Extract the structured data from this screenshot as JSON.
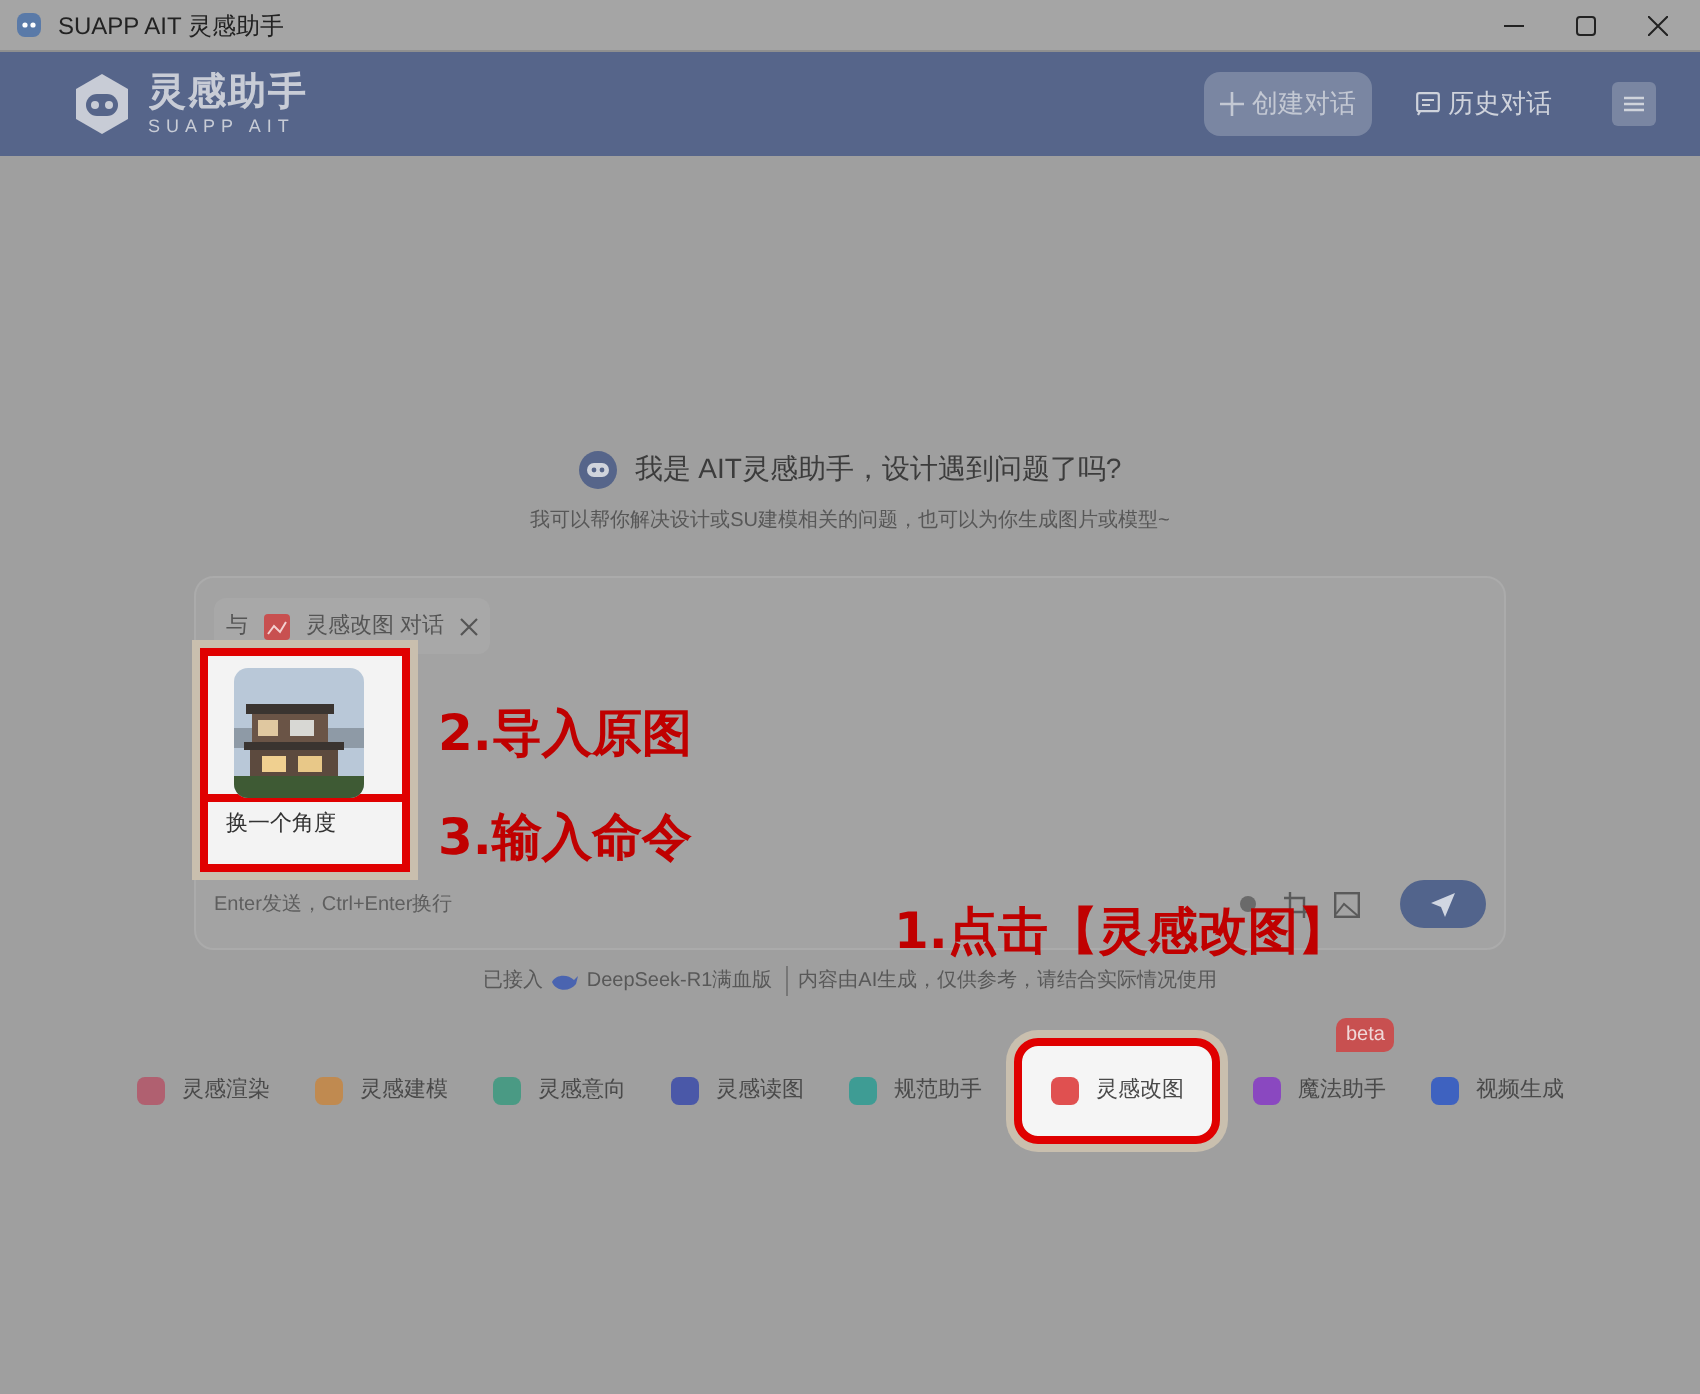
{
  "window": {
    "title": "SUAPP AIT 灵感助手"
  },
  "header": {
    "logo_title": "灵感助手",
    "logo_subtitle": "SUAPP AIT",
    "buttons": [
      {
        "label": "创建对话",
        "kind": "create"
      },
      {
        "label": "历史对话",
        "kind": "history"
      }
    ]
  },
  "welcome": {
    "title": "我是 AIT灵感助手，设计遇到问题了吗?",
    "subtitle": "我可以帮你解决设计或SU建模相关的问题，也可以为你生成图片或模型~"
  },
  "chat": {
    "chip": {
      "prefix": "与",
      "tool": "灵感改图",
      "suffix": "对话"
    },
    "image": {
      "kind": "picture",
      "highlighted": true
    },
    "input": {
      "value": "换一个角度",
      "highlighted": true
    },
    "placeholder": "Enter发送，Ctrl+Enter换行"
  },
  "disclaimer": {
    "prefix": "已接入",
    "model": "DeepSeek-R1满血版",
    "note": "内容由AI生成，仅供参考，请结合实际情况使用"
  },
  "tools": [
    {
      "label": "灵感渲染",
      "color": "#b06070",
      "highlighted": false
    },
    {
      "label": "灵感建模",
      "color": "#c08a50",
      "highlighted": false
    },
    {
      "label": "灵感意向",
      "color": "#4a9a84",
      "highlighted": false
    },
    {
      "label": "灵感读图",
      "color": "#4a58a8",
      "highlighted": false
    },
    {
      "label": "规范助手",
      "color": "#3e9c94",
      "highlighted": false
    },
    {
      "label": "灵感改图",
      "color": "#e05050",
      "highlighted": true
    },
    {
      "label": "魔法助手",
      "color": "#8a48c0",
      "highlighted": false,
      "badge": "beta"
    },
    {
      "label": "视频生成",
      "color": "#3e62c0",
      "highlighted": false
    }
  ],
  "annotations": [
    {
      "text": "2.导入原图"
    },
    {
      "text": "3.输入命令"
    },
    {
      "text": "1.点击【灵感改图】"
    }
  ]
}
